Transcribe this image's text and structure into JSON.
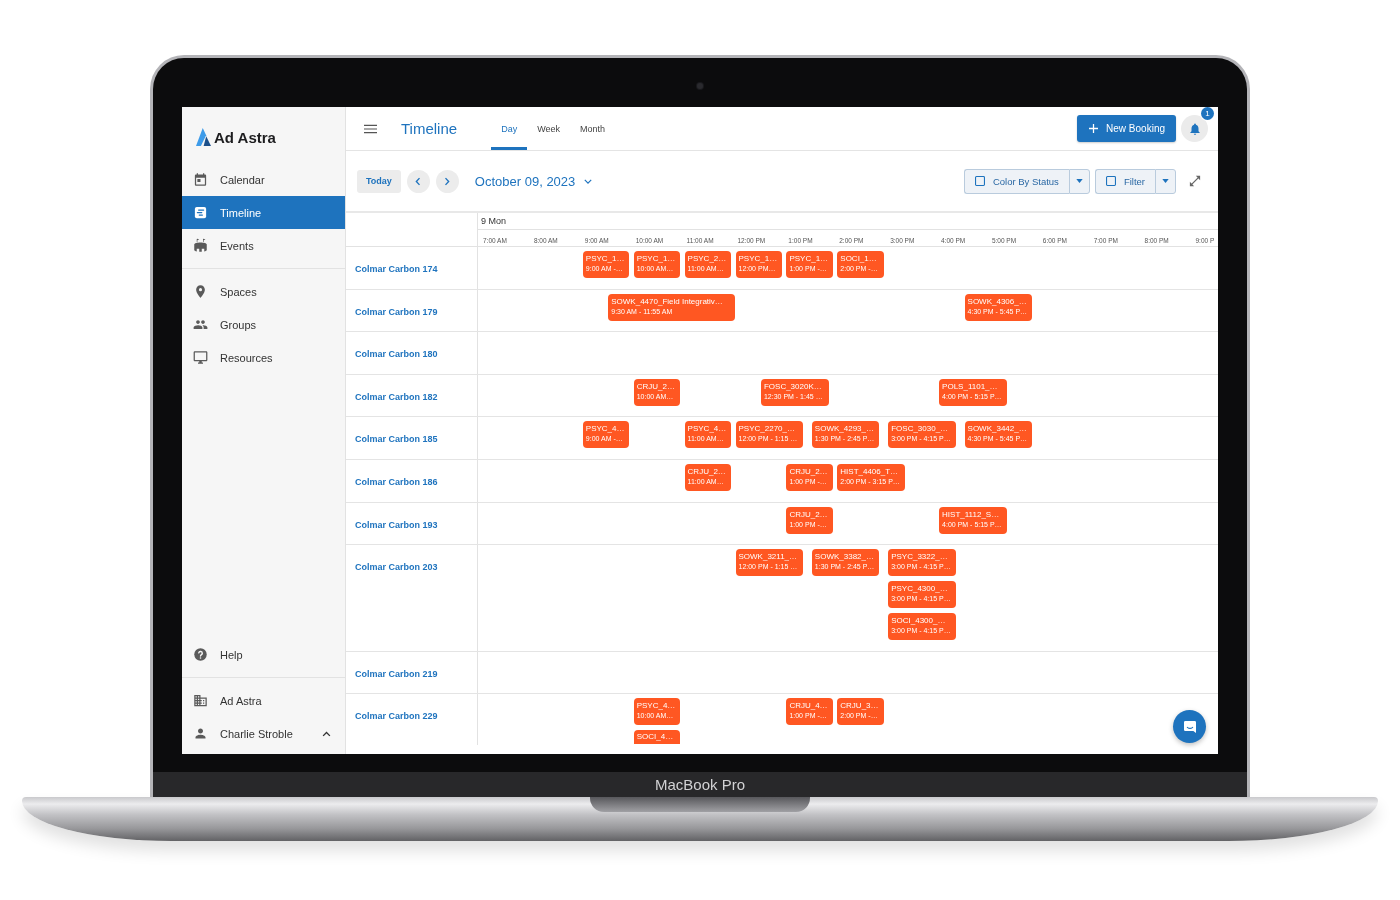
{
  "sidebar": {
    "brand": "Ad Astra",
    "sections": [
      {
        "items": [
          {
            "label": "Calendar",
            "selected": false
          },
          {
            "label": "Timeline",
            "selected": true
          },
          {
            "label": "Events",
            "selected": false
          }
        ]
      },
      {
        "items": [
          {
            "label": "Spaces",
            "selected": false
          },
          {
            "label": "Groups",
            "selected": false
          },
          {
            "label": "Resources",
            "selected": false
          }
        ]
      }
    ],
    "footer": [
      {
        "items": [
          {
            "label": "Help",
            "selected": false,
            "kind": "link"
          }
        ]
      },
      {
        "items": [
          {
            "label": "Ad Astra",
            "selected": false,
            "kind": "link"
          },
          {
            "label": "Charlie Stroble",
            "selected": false,
            "kind": "menu"
          }
        ]
      }
    ]
  },
  "top_bar": {
    "title": "Timeline",
    "tabs": [
      {
        "label": "Day",
        "selected": true
      },
      {
        "label": "Week",
        "selected": false
      },
      {
        "label": "Month",
        "selected": false
      }
    ],
    "new_booking": "New Booking",
    "notification_count": "1"
  },
  "toolbar": {
    "today": "Today",
    "date": "October 09, 2023",
    "toggles": [
      {
        "label": "Color By Status",
        "checked": false
      },
      {
        "label": "Filter",
        "checked": false
      }
    ]
  },
  "timeline": {
    "day": "9 Mon",
    "hours": [
      "7:00 AM",
      "8:00 AM",
      "9:00 AM",
      "10:00 AM",
      "11:00 AM",
      "12:00 PM",
      "1:00 PM",
      "2:00 PM",
      "3:00 PM",
      "4:00 PM",
      "5:00 PM",
      "6:00 PM",
      "7:00 PM",
      "8:00 PM",
      "9:00 P"
    ],
    "rooms": [
      {
        "name": "Colmar Carbon 174",
        "events": [
          {
            "title": "PSYC_1…",
            "time": "9:00 AM -…"
          },
          {
            "title": "PSYC_1…",
            "time": "10:00 AM…"
          },
          {
            "title": "PSYC_2…",
            "time": "11:00 AM…"
          },
          {
            "title": "PSYC_1…",
            "time": "12:00 PM…"
          },
          {
            "title": "PSYC_1…",
            "time": "1:00 PM -…"
          },
          {
            "title": "SOCI_1…",
            "time": "2:00 PM -…"
          }
        ]
      },
      {
        "name": "Colmar Carbon 179",
        "events": [
          {
            "title": "SOWK_4470_Field Integrativ…",
            "time": "9:30 AM - 11:55 AM"
          },
          {
            "title": "SOWK_4306_…",
            "time": "4:30 PM - 5:45 P…"
          }
        ]
      },
      {
        "name": "Colmar Carbon 180"
      },
      {
        "name": "Colmar Carbon 182",
        "events": [
          {
            "title": "CRJU_2…",
            "time": "10:00 AM…"
          },
          {
            "title": "FOSC_3020K…",
            "time": "12:30 PM - 1:45 …"
          },
          {
            "title": "POLS_1101_…",
            "time": "4:00 PM - 5:15 P…"
          }
        ]
      },
      {
        "name": "Colmar Carbon 185",
        "events": [
          {
            "title": "PSYC_4…",
            "time": "9:00 AM -…"
          },
          {
            "title": "PSYC_4…",
            "time": "11:00 AM…"
          },
          {
            "title": "PSYC_2270_…",
            "time": "12:00 PM - 1:15 …"
          },
          {
            "title": "SOWK_4293_…",
            "time": "1:30 PM - 2:45 P…"
          },
          {
            "title": "FOSC_3030_…",
            "time": "3:00 PM - 4:15 P…"
          },
          {
            "title": "SOWK_3442_…",
            "time": "4:30 PM - 5:45 P…"
          }
        ]
      },
      {
        "name": "Colmar Carbon 186",
        "events": [
          {
            "title": "CRJU_2…",
            "time": "11:00 AM…"
          },
          {
            "title": "CRJU_2…",
            "time": "1:00 PM -…"
          },
          {
            "title": "HIST_4406_T…",
            "time": "2:00 PM - 3:15 P…"
          }
        ]
      },
      {
        "name": "Colmar Carbon 193",
        "events": [
          {
            "title": "CRJU_2…",
            "time": "1:00 PM -…"
          },
          {
            "title": "HIST_1112_S…",
            "time": "4:00 PM - 5:15 P…"
          }
        ]
      },
      {
        "name": "Colmar Carbon 203",
        "events": [
          {
            "title": "SOWK_3211_…",
            "time": "12:00 PM - 1:15 …"
          },
          {
            "title": "SOWK_3382_…",
            "time": "1:30 PM - 2:45 P…"
          },
          {
            "title": "PSYC_3322_…",
            "time": "3:00 PM - 4:15 P…"
          },
          {
            "title": "PSYC_4300_…",
            "time": "3:00 PM - 4:15 P…"
          },
          {
            "title": "SOCI_4300_…",
            "time": "3:00 PM - 4:15 P…"
          }
        ]
      },
      {
        "name": "Colmar Carbon 219"
      },
      {
        "name": "Colmar Carbon 229",
        "events": [
          {
            "title": "PSYC_4…",
            "time": "10:00 AM…"
          },
          {
            "title": "CRJU_4…",
            "time": "1:00 PM -…"
          },
          {
            "title": "CRJU_3…",
            "time": "2:00 PM -…"
          },
          {
            "title": "SOCI_4…"
          }
        ]
      }
    ]
  },
  "device": {
    "label": "MacBook Pro"
  }
}
